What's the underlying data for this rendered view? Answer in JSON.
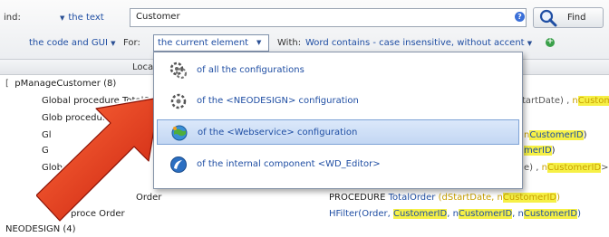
{
  "search": {
    "find_label": "ind:",
    "mode": "the text",
    "value": "Customer",
    "find_button": "Find"
  },
  "filters": {
    "scope": "the code and GUI",
    "for_label": "For:",
    "for_value": "the current element",
    "with_label": "With:",
    "with_value": "Word contains - case insensitive, without accent"
  },
  "results": {
    "column_header": "Loca",
    "rows": [
      {
        "c1": "pManageCustomer (8)",
        "c2": ""
      },
      {
        "c1": "Global procedure TotalOr",
        "c2": ""
      },
      {
        "c1": "Glob procedure TotalOr",
        "c2": ""
      },
      {
        "c1": "Gl",
        "c2": ""
      },
      {
        "c1": "G",
        "c2": ""
      },
      {
        "c1": "Global",
        "c2": ""
      },
      {
        "c1": "",
        "c2": ""
      },
      {
        "c1": "Order",
        "c2": ""
      },
      {
        "c1": "proce      Order",
        "c2": ""
      },
      {
        "c1": "NEODESIGN (4)",
        "c2": ""
      }
    ],
    "code_fragments": {
      "r1_a": "tartDate) , ",
      "r1_b": "n",
      "r1_c": "Custome",
      "r3_a": "n",
      "r3_b": "CustomerID",
      "r3_c": ")",
      "r4_a": "merID",
      "r4_b": ")",
      "r5_a": "e) , ",
      "r5_b": "n",
      "r5_c": "CustomerID",
      "r5_d": ">",
      "r7_kw": "PROCEDURE",
      "r7_fn": "TotalOrder",
      "r7_p1": "(dStartDate, n",
      "r7_hl": "CustomerID",
      "r7_end": ")",
      "r8_fn": "HFilter",
      "r8_a": "(Order, ",
      "r8_hl1": "CustomerID",
      "r8_b": ", n",
      "r8_hl2": "CustomerID",
      "r8_c": ", n",
      "r8_hl3": "CustomerID",
      "r8_d": ")"
    }
  },
  "dropdown": {
    "items": [
      {
        "label": "of all the configurations",
        "icon": "all-configurations-icon"
      },
      {
        "label": "of the <NEODESIGN> configuration",
        "icon": "configuration-icon"
      },
      {
        "label": "of the <Webservice> configuration",
        "icon": "webservice-icon"
      },
      {
        "label": "of the internal component <WD_Editor>",
        "icon": "internal-component-icon"
      }
    ],
    "selected_index": 2
  },
  "colors": {
    "link_blue": "#1f4ea3",
    "highlight": "#f6f046",
    "arrow_red": "#e23a1e",
    "selection": "#c3d7f3"
  }
}
